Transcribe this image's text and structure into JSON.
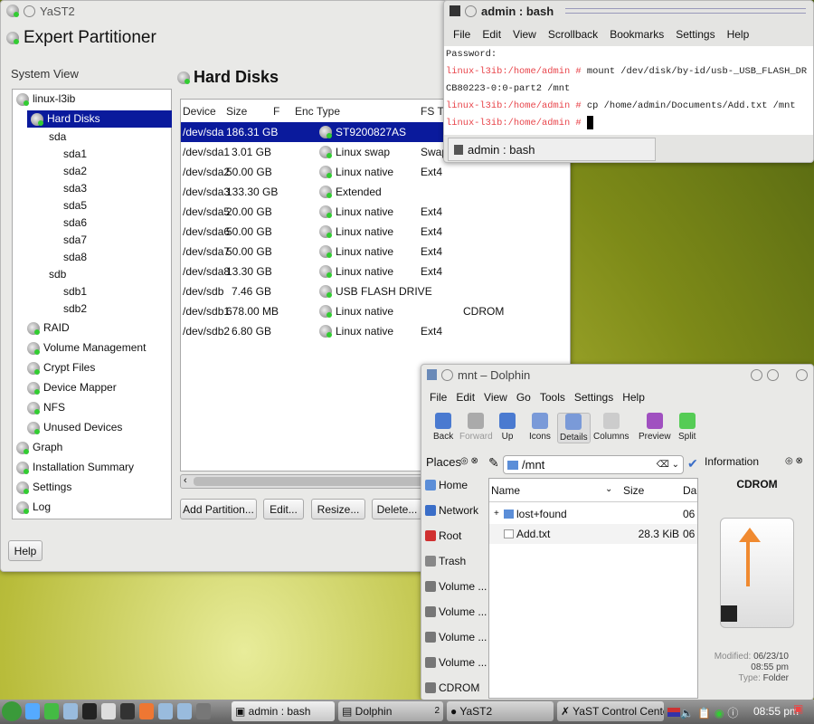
{
  "yast": {
    "window_title": "YaST2",
    "heading": "Expert Partitioner",
    "system_view_label": "System View",
    "panel_title": "Hard Disks",
    "tree": [
      {
        "label": "linux-l3ib",
        "level": 0
      },
      {
        "label": "Hard Disks",
        "level": 1,
        "selected": true
      },
      {
        "label": "sda",
        "level": 2
      },
      {
        "label": "sda1",
        "level": 3
      },
      {
        "label": "sda2",
        "level": 3
      },
      {
        "label": "sda3",
        "level": 3
      },
      {
        "label": "sda5",
        "level": 3
      },
      {
        "label": "sda6",
        "level": 3
      },
      {
        "label": "sda7",
        "level": 3
      },
      {
        "label": "sda8",
        "level": 3
      },
      {
        "label": "sdb",
        "level": 2
      },
      {
        "label": "sdb1",
        "level": 3
      },
      {
        "label": "sdb2",
        "level": 3
      },
      {
        "label": "RAID",
        "level": 1
      },
      {
        "label": "Volume Management",
        "level": 1
      },
      {
        "label": "Crypt Files",
        "level": 1
      },
      {
        "label": "Device Mapper",
        "level": 1
      },
      {
        "label": "NFS",
        "level": 1
      },
      {
        "label": "Unused Devices",
        "level": 1
      },
      {
        "label": "Graph",
        "level": 0
      },
      {
        "label": "Installation Summary",
        "level": 0
      },
      {
        "label": "Settings",
        "level": 0
      },
      {
        "label": "Log",
        "level": 0
      }
    ],
    "columns": [
      "Device",
      "Size",
      "F",
      "Enc",
      "Type",
      "FS Ty"
    ],
    "rows": [
      {
        "device": "/dev/sda",
        "size": "186.31 GB",
        "type": "ST9200827AS",
        "fs": "",
        "label": "",
        "selected": true
      },
      {
        "device": "/dev/sda1",
        "size": "3.01 GB",
        "type": "Linux swap",
        "fs": "Swap",
        "label": ""
      },
      {
        "device": "/dev/sda2",
        "size": "50.00 GB",
        "type": "Linux native",
        "fs": "Ext4",
        "label": ""
      },
      {
        "device": "/dev/sda3",
        "size": "133.30 GB",
        "type": "Extended",
        "fs": "",
        "label": ""
      },
      {
        "device": "/dev/sda5",
        "size": "20.00 GB",
        "type": "Linux native",
        "fs": "Ext4",
        "label": ""
      },
      {
        "device": "/dev/sda6",
        "size": "50.00 GB",
        "type": "Linux native",
        "fs": "Ext4",
        "label": ""
      },
      {
        "device": "/dev/sda7",
        "size": "50.00 GB",
        "type": "Linux native",
        "fs": "Ext4",
        "label": ""
      },
      {
        "device": "/dev/sda8",
        "size": "13.30 GB",
        "type": "Linux native",
        "fs": "Ext4",
        "label": ""
      },
      {
        "device": "/dev/sdb",
        "size": "7.46 GB",
        "type": "USB FLASH DRIVE",
        "fs": "",
        "label": ""
      },
      {
        "device": "/dev/sdb1",
        "size": "678.00 MB",
        "type": "Linux native",
        "fs": "",
        "label": "CDROM"
      },
      {
        "device": "/dev/sdb2",
        "size": "6.80 GB",
        "type": "Linux native",
        "fs": "Ext4",
        "label": ""
      }
    ],
    "buttons": {
      "add": "Add Partition...",
      "edit": "Edit...",
      "resize": "Resize...",
      "delete": "Delete...",
      "help": "Help"
    }
  },
  "konsole": {
    "title": "admin : bash",
    "menu": [
      "File",
      "Edit",
      "View",
      "Scrollback",
      "Bookmarks",
      "Settings",
      "Help"
    ],
    "lines": [
      {
        "prompt": "",
        "text": "Password:"
      },
      {
        "prompt": "linux-l3ib:/home/admin #",
        "text": " mount /dev/disk/by-id/usb-_USB_FLASH_DR"
      },
      {
        "prompt": "",
        "text": "CB80223-0:0-part2 /mnt"
      },
      {
        "prompt": "linux-l3ib:/home/admin #",
        "text": " cp /home/admin/Documents/Add.txt /mnt"
      },
      {
        "prompt": "linux-l3ib:/home/admin #",
        "text": " "
      }
    ],
    "tab": "admin : bash"
  },
  "dolphin": {
    "title": "mnt – Dolphin",
    "menu": [
      "File",
      "Edit",
      "View",
      "Go",
      "Tools",
      "Settings",
      "Help"
    ],
    "toolbar": [
      "Back",
      "Forward",
      "Up",
      "Icons",
      "Details",
      "Columns",
      "Preview",
      "Split"
    ],
    "places_title": "Places",
    "places": [
      "Home",
      "Network",
      "Root",
      "Trash",
      "Volume ...",
      "Volume ...",
      "Volume ...",
      "Volume ...",
      "CDROM"
    ],
    "location": "/mnt",
    "columns": [
      "Name",
      "Size",
      "Da"
    ],
    "files": [
      {
        "name": "lost+found",
        "size": "",
        "date": "06"
      },
      {
        "name": "Add.txt",
        "size": "28.3 KiB",
        "date": "06"
      }
    ],
    "info_title": "Information",
    "info_name": "CDROM",
    "modified_label": "Modified:",
    "modified": "06/23/10",
    "modified_time": "08:55 pm",
    "type_label": "Type:",
    "type": "Folder"
  },
  "taskbar": {
    "tasks": [
      "admin : bash",
      "Dolphin",
      "YaST2",
      "YaST Control Center"
    ],
    "dolphin_count": "2",
    "clock": "08:55 pm"
  }
}
